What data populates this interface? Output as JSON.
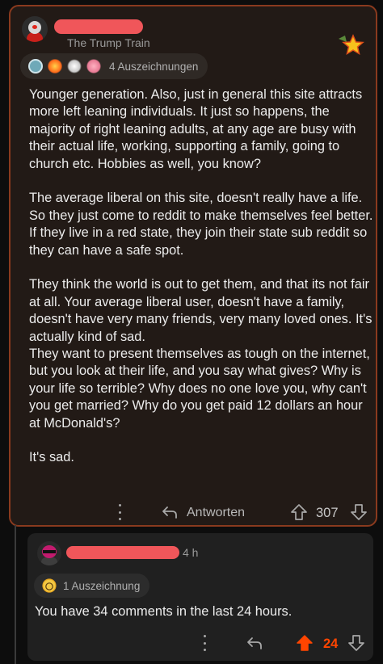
{
  "post": {
    "flair": "The Trump Train",
    "awards_label": "4 Auszeichnungen",
    "paragraphs": [
      "Younger generation. Also, just in general this site attracts more left leaning individuals. It just so happens, the majority of right leaning adults, at any age are busy with their actual life, working, supporting a family, going to church etc. Hobbies as well, you know?",
      "The average liberal on this site, doesn't really have a life. So they just come to reddit to make themselves feel better. If they live in a red state, they join their state sub reddit so they can have a safe spot.",
      "They think the world is out to get them, and that its not fair at all. Your average liberal user, doesn't have a family, doesn't have very many friends, very many loved ones. It's actually kind of sad.",
      "They want to present themselves as tough on the internet, but you look at their life, and you say what gives? Why is your life so terrible? Why does no one love you, why can't you get married? Why do you get paid 12 dollars an hour at McDonald's?",
      "It's sad."
    ],
    "reply_label": "Antworten",
    "score": "307"
  },
  "reply": {
    "time": "4 h",
    "awards_label": "1 Auszeichnung",
    "text": "You have 34 comments in the last 24 hours.",
    "score": "24"
  },
  "colors": {
    "background": "#0d0d0d",
    "card_border": "#8a3a1e",
    "redaction": "#f0565a",
    "upvote_active": "#ff4500"
  },
  "icons": [
    "overflow-menu-icon",
    "reply-arrow-icon",
    "upvote-icon",
    "downvote-icon",
    "star-award-icon"
  ]
}
